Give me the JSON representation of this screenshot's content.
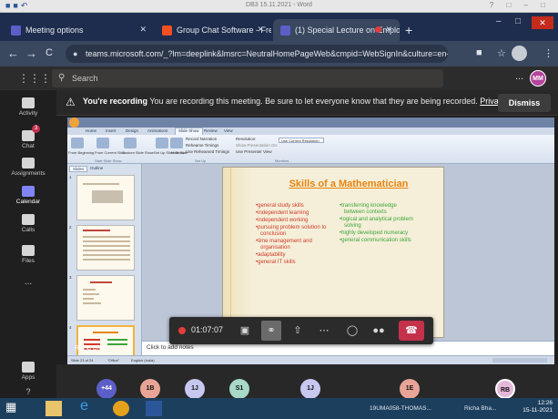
{
  "word_title": "DB3 15.11.2021 - Word",
  "browser": {
    "tabs": [
      {
        "label": "Meeting options",
        "color": "#5b5fc7"
      },
      {
        "label": "Group Chat Software - Free Chat",
        "color": "#f25022"
      },
      {
        "label": "(1) Special Lecture on Emplo",
        "color": "#5b5fc7"
      }
    ],
    "new_tab": "+",
    "url": "teams.microsoft.com/_?lm=deeplink&lmsrc=NeutralHomePageWeb&cmpid=WebSignIn&culture=en-in&country=i...",
    "back": "←",
    "forward": "→",
    "reload": "C",
    "lock": "🔒",
    "ext1": "■",
    "star": "☆",
    "menu": "⋮",
    "minimize": "–",
    "maximize": "□",
    "close": "✕"
  },
  "teams": {
    "search_placeholder": "Search",
    "more": "...",
    "user_initials": "MM",
    "rail": [
      {
        "label": "Activity",
        "selected": false
      },
      {
        "label": "Chat",
        "selected": false,
        "badge": "3"
      },
      {
        "label": "Assignments",
        "selected": false
      },
      {
        "label": "Calendar",
        "selected": true
      },
      {
        "label": "Calls",
        "selected": false
      },
      {
        "label": "Files",
        "selected": false
      },
      {
        "label": "...",
        "selected": false
      },
      {
        "label": "Apps",
        "selected": false
      },
      {
        "label": "?",
        "selected": false
      }
    ],
    "banner": {
      "icon": "⚠",
      "bold": "You're recording",
      "text": " You are recording this meeting. Be sure to let everyone know that they are being recorded. ",
      "link": "Privacy...",
      "dismiss": "Dismiss"
    }
  },
  "ppt": {
    "tabs": [
      "Home",
      "Insert",
      "Design",
      "Animations",
      "Slide Show",
      "Review",
      "View"
    ],
    "active_tab": "Slide Show",
    "ribbon": {
      "buttons": [
        "From Beginning",
        "From Current Slide",
        "Custom Slide Show",
        "Set Up Slide Show",
        "Hide Slide"
      ],
      "small": [
        "Record Narration",
        "Rehearse Timings",
        "Use Rehearsed Timings",
        "Resolution:",
        "Show Presentation On:",
        "Use Presenter View"
      ],
      "resolution_value": "Use Current Resolution",
      "groups": [
        "Start Slide Show",
        "Set Up",
        "Monitors"
      ]
    },
    "pane_tabs": [
      "Slides",
      "Outline"
    ],
    "thumb_numbers": [
      "1",
      "2",
      "3",
      "4"
    ],
    "slide": {
      "title": "Skills of a Mathematician",
      "left": [
        "general study skills",
        "independent learning",
        "independent working",
        "pursuing problem solution to conclusion",
        "time management and organisation",
        "adaptability",
        "general IT skills"
      ],
      "right": [
        "transferring knowledge between contexts",
        "logical and analytical problem solving",
        "highly developed numeracy",
        "general communication skills"
      ]
    },
    "notes": "Click to add notes",
    "status": [
      "Slide 23 of 24",
      "\"Office\"",
      "English (India)"
    ]
  },
  "call": {
    "timer": "01:07:07",
    "presenter": "Richa Bhat"
  },
  "participants": [
    {
      "initials": "+44",
      "color": "#5b5fc7",
      "text_color": "#ffffff"
    },
    {
      "initials": "1B",
      "color": "#e8a597",
      "text_color": "#222222"
    },
    {
      "initials": "1J",
      "color": "#c7c8f0",
      "text_color": "#222222"
    },
    {
      "initials": "S1",
      "color": "#a8d8c8",
      "text_color": "#222222"
    },
    {
      "initials": "1J",
      "color": "#c7c8f0",
      "text_color": "#222222"
    },
    {
      "initials": "1E",
      "color": "#e8a597",
      "text_color": "#222222"
    },
    {
      "initials": "RB",
      "color": "#e4b8d8",
      "text_color": "#222222"
    }
  ],
  "taskbar": {
    "items": [
      "19UMA058-THOMAS...",
      "Richa Bha..."
    ],
    "time": "12:26",
    "date": "15-11-2021"
  }
}
